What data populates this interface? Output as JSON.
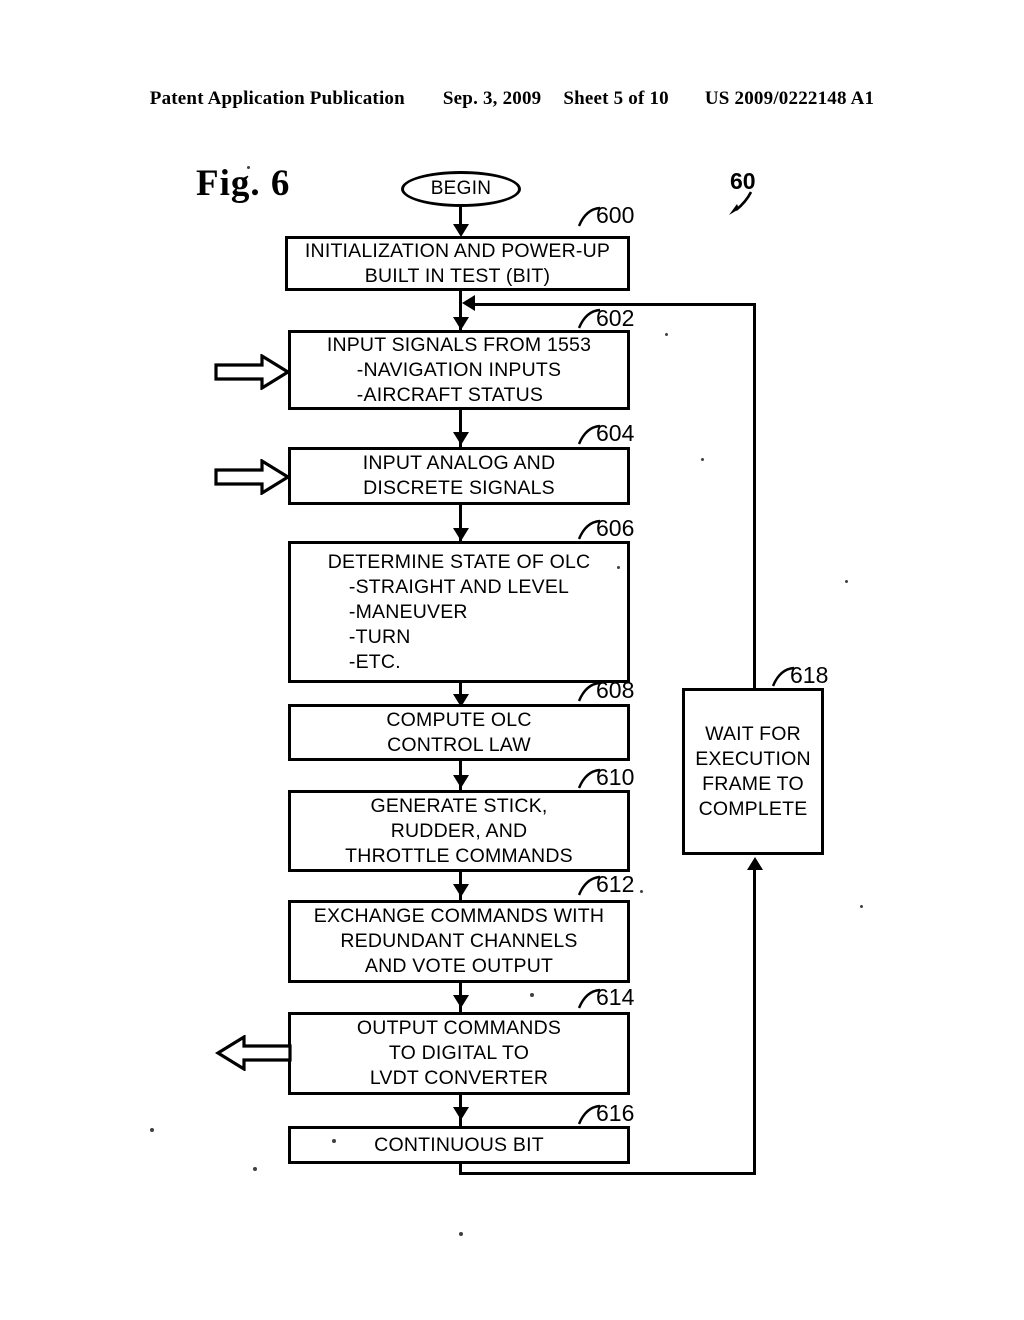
{
  "header": {
    "publication": "Patent Application Publication",
    "date": "Sep. 3, 2009",
    "sheet": "Sheet 5 of 10",
    "patent_number": "US 2009/0222148 A1"
  },
  "figure": {
    "title": "Fig. 6",
    "overall_reference": "60"
  },
  "flowchart": {
    "start_label": "BEGIN",
    "nodes": [
      {
        "ref": "600",
        "name": "initialization-and-power-up-bit",
        "lines": [
          "INITIALIZATION AND POWER-UP",
          "BUILT IN TEST (BIT)"
        ],
        "indent_lines": []
      },
      {
        "ref": "602",
        "name": "input-signals-from-1553",
        "lines": [
          "INPUT SIGNALS FROM 1553"
        ],
        "indent_lines": [
          "-NAVIGATION INPUTS",
          "-AIRCRAFT STATUS"
        ]
      },
      {
        "ref": "604",
        "name": "input-analog-and-discrete-signals",
        "lines": [
          "INPUT ANALOG AND",
          "DISCRETE SIGNALS"
        ],
        "indent_lines": []
      },
      {
        "ref": "606",
        "name": "determine-state-of-olc",
        "lines": [
          "DETERMINE STATE OF OLC"
        ],
        "indent_lines": [
          "-STRAIGHT AND LEVEL",
          "-MANEUVER",
          "-TURN",
          "-ETC."
        ]
      },
      {
        "ref": "608",
        "name": "compute-olc-control-law",
        "lines": [
          "COMPUTE OLC",
          "CONTROL LAW"
        ],
        "indent_lines": []
      },
      {
        "ref": "610",
        "name": "generate-stick-rudder-throttle-commands",
        "lines": [
          "GENERATE STICK,",
          "RUDDER, AND",
          "THROTTLE COMMANDS"
        ],
        "indent_lines": []
      },
      {
        "ref": "612",
        "name": "exchange-commands-redundant-channels",
        "lines": [
          "EXCHANGE COMMANDS WITH",
          "REDUNDANT CHANNELS",
          "AND VOTE OUTPUT"
        ],
        "indent_lines": []
      },
      {
        "ref": "614",
        "name": "output-commands-to-lvdt-converter",
        "lines": [
          "OUTPUT COMMANDS",
          "TO DIGITAL TO",
          "LVDT CONVERTER"
        ],
        "indent_lines": []
      },
      {
        "ref": "616",
        "name": "continuous-bit",
        "lines": [
          "CONTINUOUS BIT"
        ],
        "indent_lines": []
      },
      {
        "ref": "618",
        "name": "wait-for-execution-frame-to-complete",
        "lines": [
          "WAIT FOR",
          "EXECUTION",
          "FRAME TO",
          "COMPLETE"
        ],
        "indent_lines": []
      }
    ]
  },
  "colors": {
    "ink": "#000000",
    "paper": "#ffffff"
  }
}
